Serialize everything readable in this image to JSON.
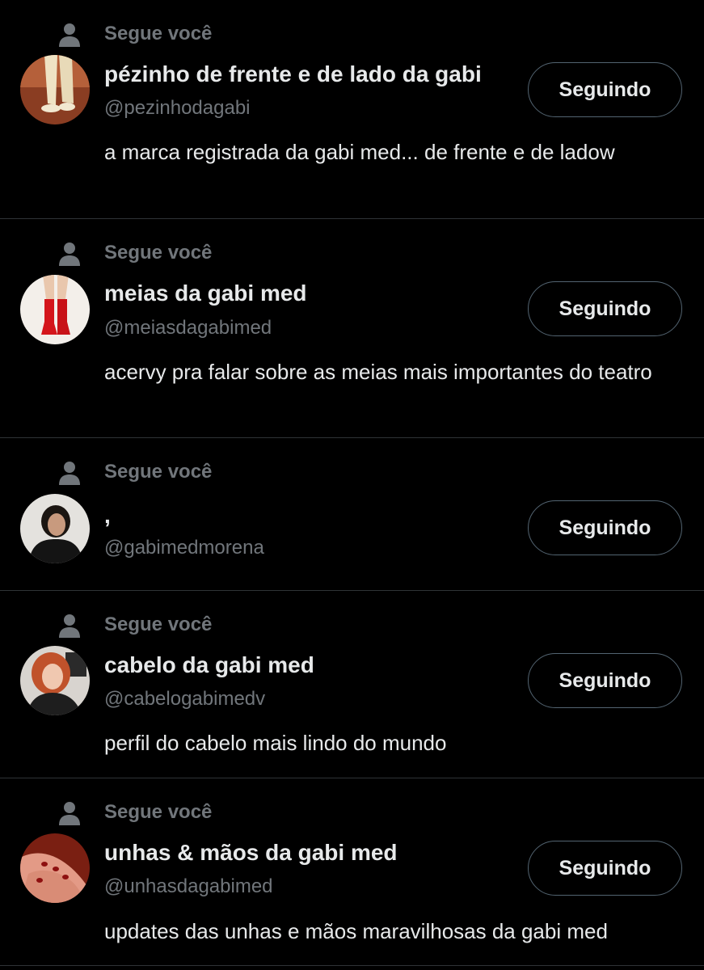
{
  "accounts": [
    {
      "context_label": "Segue você",
      "name": "pézinho de frente e de lado da gabi",
      "handle": "@pezinhodagabi",
      "bio": "a marca registrada da gabi med... de frente e de ladow",
      "button_label": "Seguindo",
      "avatar_icon": "feet-photo-avatar"
    },
    {
      "context_label": "Segue você",
      "name": "meias da gabi med",
      "handle": "@meiasdagabimed",
      "bio": "acervy pra falar sobre as meias mais importantes do teatro",
      "button_label": "Seguindo",
      "avatar_icon": "red-socks-photo-avatar"
    },
    {
      "context_label": "Segue você",
      "name": ",",
      "handle": "@gabimedmorena",
      "bio": "",
      "button_label": "Seguindo",
      "avatar_icon": "portrait-photo-avatar"
    },
    {
      "context_label": "Segue você",
      "name": "cabelo da gabi med",
      "handle": "@cabelogabimedv",
      "bio": "perfil do cabelo mais lindo do mundo",
      "button_label": "Seguindo",
      "avatar_icon": "red-hair-photo-avatar"
    },
    {
      "context_label": "Segue você",
      "name": "unhas & mãos da gabi med",
      "handle": "@unhasdagabimed",
      "bio": "updates das unhas e mãos maravilhosas da gabi med",
      "button_label": "Seguindo",
      "avatar_icon": "nails-hands-photo-avatar"
    }
  ],
  "colors": {
    "background": "#000000",
    "primary_text": "#e7e9ea",
    "secondary_text": "#71767b",
    "divider": "#2f3336",
    "button_border": "#536471"
  }
}
